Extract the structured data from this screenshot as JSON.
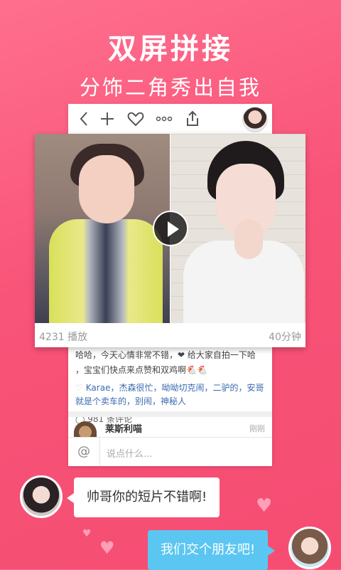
{
  "hero": {
    "title": "双屏拼接",
    "subtitle": "分饰二角秀出自我"
  },
  "toolbar": {
    "icons": [
      "back-icon",
      "plus-icon",
      "heart-icon",
      "more-icon",
      "share-icon",
      "avatar"
    ]
  },
  "video": {
    "plays": "4231 播放",
    "duration": "40分钟"
  },
  "post": {
    "text_line1": "哈哈，今天心情非常不错，❤ 给大家自拍一下哈",
    "text_line2": "，宝宝们快点来点赞和双鸡啊🐔🐔",
    "likes": "Karae，杰森很忙，呦呦切克闹，二驴的，安哥就是个卖车的，别闹，神秘人",
    "comments": "981 条评论"
  },
  "comment": {
    "user": "莱斯利喵",
    "time": "刚刚"
  },
  "input": {
    "at": "@",
    "placeholder": "说点什么..."
  },
  "chat": {
    "message1": "帅哥你的短片不错啊!",
    "message2": "我们交个朋友吧!"
  },
  "colors": {
    "background": "#f85378",
    "bubble_right": "#5bc6f1",
    "link": "#3a6ab0"
  }
}
